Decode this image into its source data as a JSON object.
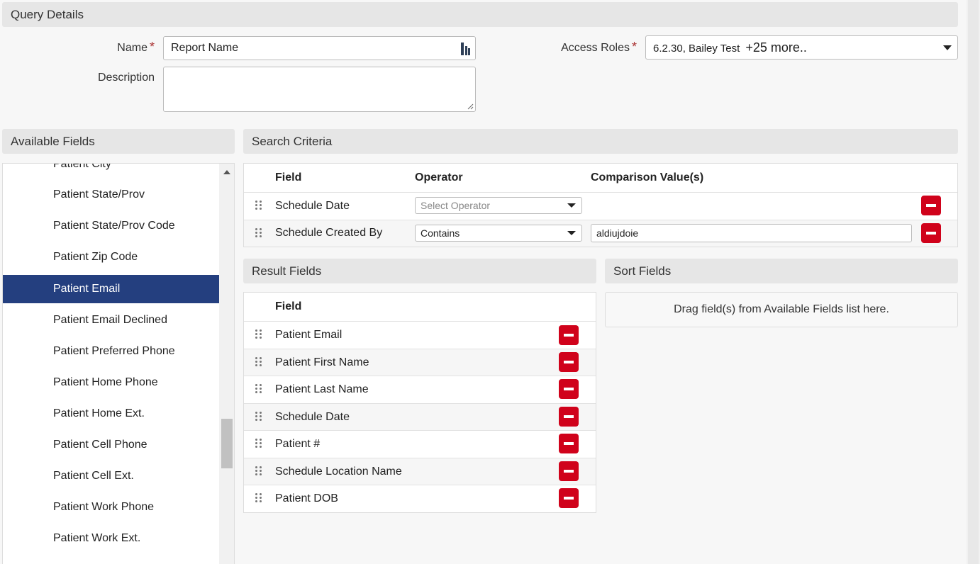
{
  "query_details": {
    "title": "Query Details",
    "name_label": "Name",
    "name_value": "Report Name",
    "description_label": "Description",
    "description_value": "",
    "access_roles_label": "Access Roles",
    "access_roles_value": "6.2.30, Bailey Test",
    "access_roles_more": "+25 more..",
    "required_marker": "*"
  },
  "available_fields": {
    "title": "Available Fields",
    "items": [
      {
        "label": "Patient City"
      },
      {
        "label": "Patient State/Prov"
      },
      {
        "label": "Patient State/Prov Code"
      },
      {
        "label": "Patient Zip Code"
      },
      {
        "label": "Patient Email"
      },
      {
        "label": "Patient Email Declined"
      },
      {
        "label": "Patient Preferred Phone"
      },
      {
        "label": "Patient Home Phone"
      },
      {
        "label": "Patient Home Ext."
      },
      {
        "label": "Patient Cell Phone"
      },
      {
        "label": "Patient Cell Ext."
      },
      {
        "label": "Patient Work Phone"
      },
      {
        "label": "Patient Work Ext."
      }
    ],
    "selected_label": "Patient Email"
  },
  "search_criteria": {
    "title": "Search Criteria",
    "columns": {
      "field": "Field",
      "operator": "Operator",
      "comparison": "Comparison Value(s)"
    },
    "rows": [
      {
        "field": "Schedule Date",
        "operator": "",
        "operator_placeholder": "Select Operator",
        "value": ""
      },
      {
        "field": "Schedule Created By",
        "operator": "Contains",
        "operator_placeholder": "",
        "value": "aldiujdoie"
      }
    ]
  },
  "result_fields": {
    "title": "Result Fields",
    "column": "Field",
    "rows": [
      {
        "field": "Patient Email"
      },
      {
        "field": "Patient First Name"
      },
      {
        "field": "Patient Last Name"
      },
      {
        "field": "Schedule Date"
      },
      {
        "field": "Patient #"
      },
      {
        "field": "Schedule Location Name"
      },
      {
        "field": "Patient DOB"
      }
    ]
  },
  "sort_fields": {
    "title": "Sort Fields",
    "empty_text": "Drag field(s) from Available Fields list here."
  },
  "colors": {
    "selected_bg": "#243f7f",
    "remove_button": "#d0021b",
    "header_bg": "#e6e6e6"
  },
  "icons": {
    "remove": "minus-icon",
    "drag": "drag-handle-icon",
    "dropdown": "chevron-down-icon"
  }
}
